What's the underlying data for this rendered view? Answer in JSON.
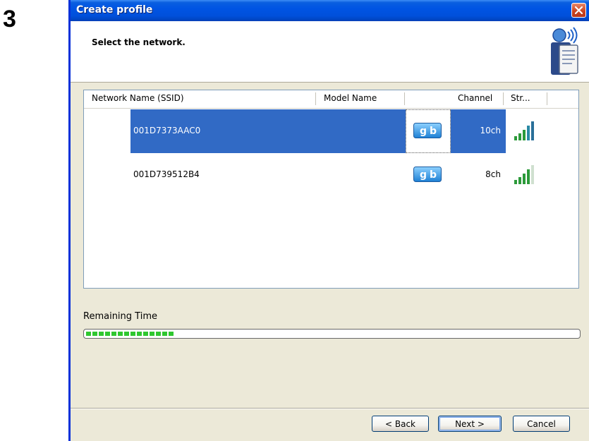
{
  "step_number": "3",
  "window": {
    "title": "Create profile",
    "header_title": "Select the network.",
    "close_icon": "close-icon"
  },
  "list": {
    "columns": [
      "Network Name (SSID)",
      "Model Name",
      "",
      "Channel",
      "Str..."
    ],
    "rows": [
      {
        "ssid": "001D7373AAC0",
        "model": "",
        "mode_icon": "gb-icon",
        "channel": "10ch",
        "signal_bars": 5,
        "selected": true
      },
      {
        "ssid": "001D739512B4",
        "model": "",
        "mode_icon": "gb-icon",
        "channel": "8ch",
        "signal_bars": 5,
        "selected": false
      }
    ]
  },
  "remaining_time": {
    "label": "Remaining Time",
    "progress_fraction": 0.18
  },
  "buttons": {
    "back_label": "< Back",
    "next_label": "Next >",
    "cancel_label": "Cancel"
  },
  "colors": {
    "selection": "#316ac5",
    "titlebar": "#0054e3",
    "progress": "#2fc72f"
  }
}
